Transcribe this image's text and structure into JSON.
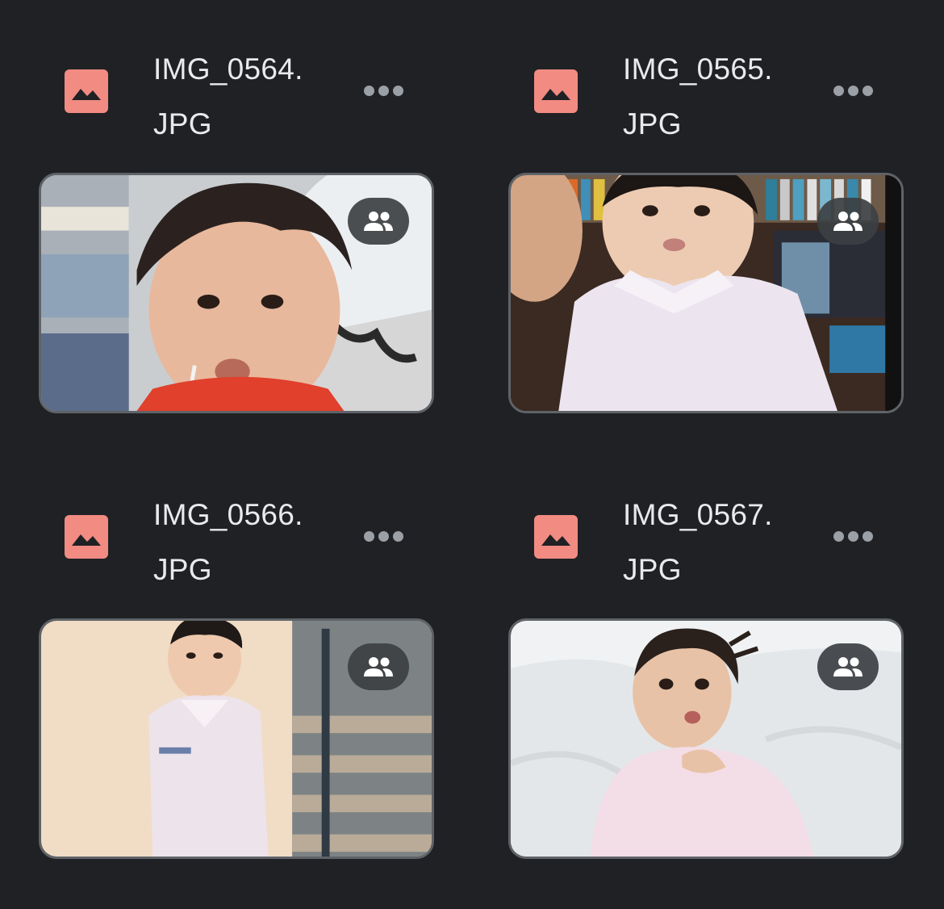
{
  "colors": {
    "background": "#202124",
    "text": "#e8eaed",
    "image_icon": "#f28b82",
    "more_dots": "#9aa0a6",
    "badge_bg": "#3c4043"
  },
  "files": [
    {
      "name_line1": "IMG_0564.",
      "name_line2": "JPG",
      "type_icon": "image-icon",
      "shared_icon": "people-icon",
      "menu_icon": "more-horizontal-icon"
    },
    {
      "name_line1": "IMG_0565.",
      "name_line2": "JPG",
      "type_icon": "image-icon",
      "shared_icon": "people-icon",
      "menu_icon": "more-horizontal-icon"
    },
    {
      "name_line1": "IMG_0566.",
      "name_line2": "JPG",
      "type_icon": "image-icon",
      "shared_icon": "people-icon",
      "menu_icon": "more-horizontal-icon"
    },
    {
      "name_line1": "IMG_0567.",
      "name_line2": "JPG",
      "type_icon": "image-icon",
      "shared_icon": "people-icon",
      "menu_icon": "more-horizontal-icon"
    }
  ]
}
